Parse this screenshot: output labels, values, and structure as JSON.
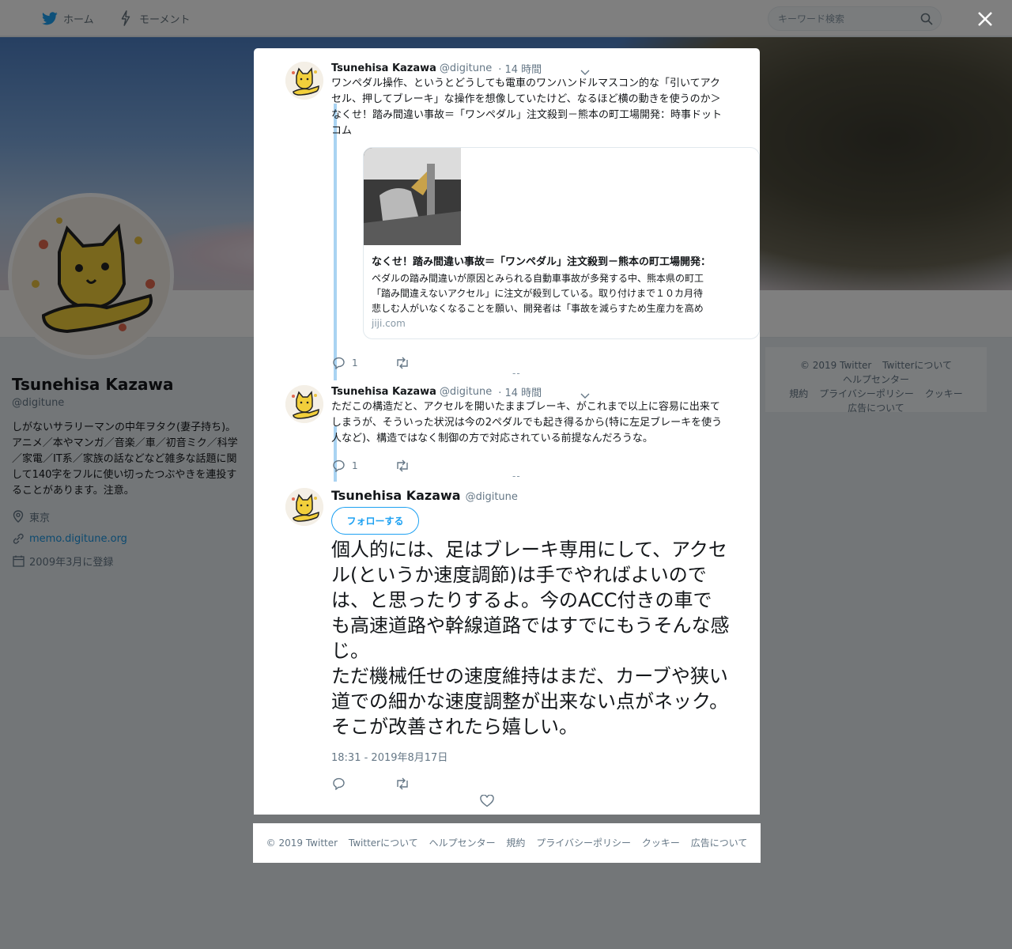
{
  "topnav": {
    "home_label": "ホーム",
    "moments_label": "モーメント",
    "search_placeholder": "キーワード検索"
  },
  "profile": {
    "name": "Tsunehisa Kazawa",
    "handle": "@digitune",
    "bio": "しがないサラリーマンの中年ヲタク(妻子持ち)。アニメ／本やマンガ／音楽／車／初音ミク／科学／家電／IT系／家族の話などなど雑多な話題に関して140字をフルに使い切ったつぶやきを連投することがあります。注意。",
    "location": "東京",
    "website": "memo.digitune.org",
    "joined": "2009年3月に登録"
  },
  "sidebar_footer": {
    "links": [
      "© 2019 Twitter",
      "Twitterについて",
      "ヘルプセンター",
      "規約",
      "プライバシーポリシー",
      "クッキー",
      "広告について"
    ]
  },
  "thread": [
    {
      "name": "Tsunehisa Kazawa",
      "handle": "@digitune",
      "time": "· 14 時間",
      "text": "ワンペダル操作、というとどうしても電車のワンハンドルマスコン的な「引いてアクセル、押してブレーキ」な操作を想像していたけど、なるほど横の動きを使うのか＞なくせ！踏み間違い事故＝「ワンペダル」注文殺到－熊本の町工場開発：時事ドットコム",
      "reply_count": "1",
      "card": {
        "title": "なくせ！踏み間違い事故＝「ワンペダル」注文殺到－熊本の町工場開発：",
        "desc_lines": [
          "ペダルの踏み間違いが原因とみられる自動車事故が多発する中、熊本県の町工",
          "「踏み間違えないアクセル」に注文が殺到している。取り付けまで１０カ月待",
          "悲しむ人がいなくなることを願い、開発者は「事故を減らすため生産力を高め"
        ],
        "domain": "jiji.com"
      }
    },
    {
      "name": "Tsunehisa Kazawa",
      "handle": "@digitune",
      "time": "· 14 時間",
      "text": "ただこの構造だと、アクセルを開いたままブレーキ、がこれまで以上に容易に出来てしまうが、そういった状況は今の2ペダルでも起き得るから(特に左足ブレーキを使う人など)、構造ではなく制御の方で対応されている前提なんだろうな。",
      "reply_count": "1"
    }
  ],
  "main_tweet": {
    "name": "Tsunehisa Kazawa",
    "handle": "@digitune",
    "follow_label": "フォローする",
    "text": "個人的には、足はブレーキ専用にして、アクセル(というか速度調節)は手でやればよいのでは、と思ったりするよ。今のACC付きの車でも高速道路や幹線道路ではすでにもうそんな感じ。\nただ機械任せの速度維持はまだ、カーブや狭い道での細かな速度調整が出来ない点がネック。そこが改善されたら嬉しい。",
    "timestamp": "18:31 - 2019年8月17日"
  },
  "modal_footer": {
    "links": [
      "© 2019 Twitter",
      "Twitterについて",
      "ヘルプセンター",
      "規約",
      "プライバシーポリシー",
      "クッキー",
      "広告について"
    ]
  },
  "colors": {
    "accent": "#1da1f2",
    "thread_line": "#a9d3f2",
    "secondary_text": "#657786"
  },
  "icons": {
    "home": "twitter-bird-icon",
    "moments": "lightning-icon",
    "search": "search-icon",
    "close": "close-icon",
    "reply": "reply-icon",
    "retweet": "retweet-icon",
    "like": "heart-icon",
    "caret": "chevron-down-icon",
    "location": "location-pin-icon",
    "link": "link-icon",
    "calendar": "calendar-icon"
  }
}
